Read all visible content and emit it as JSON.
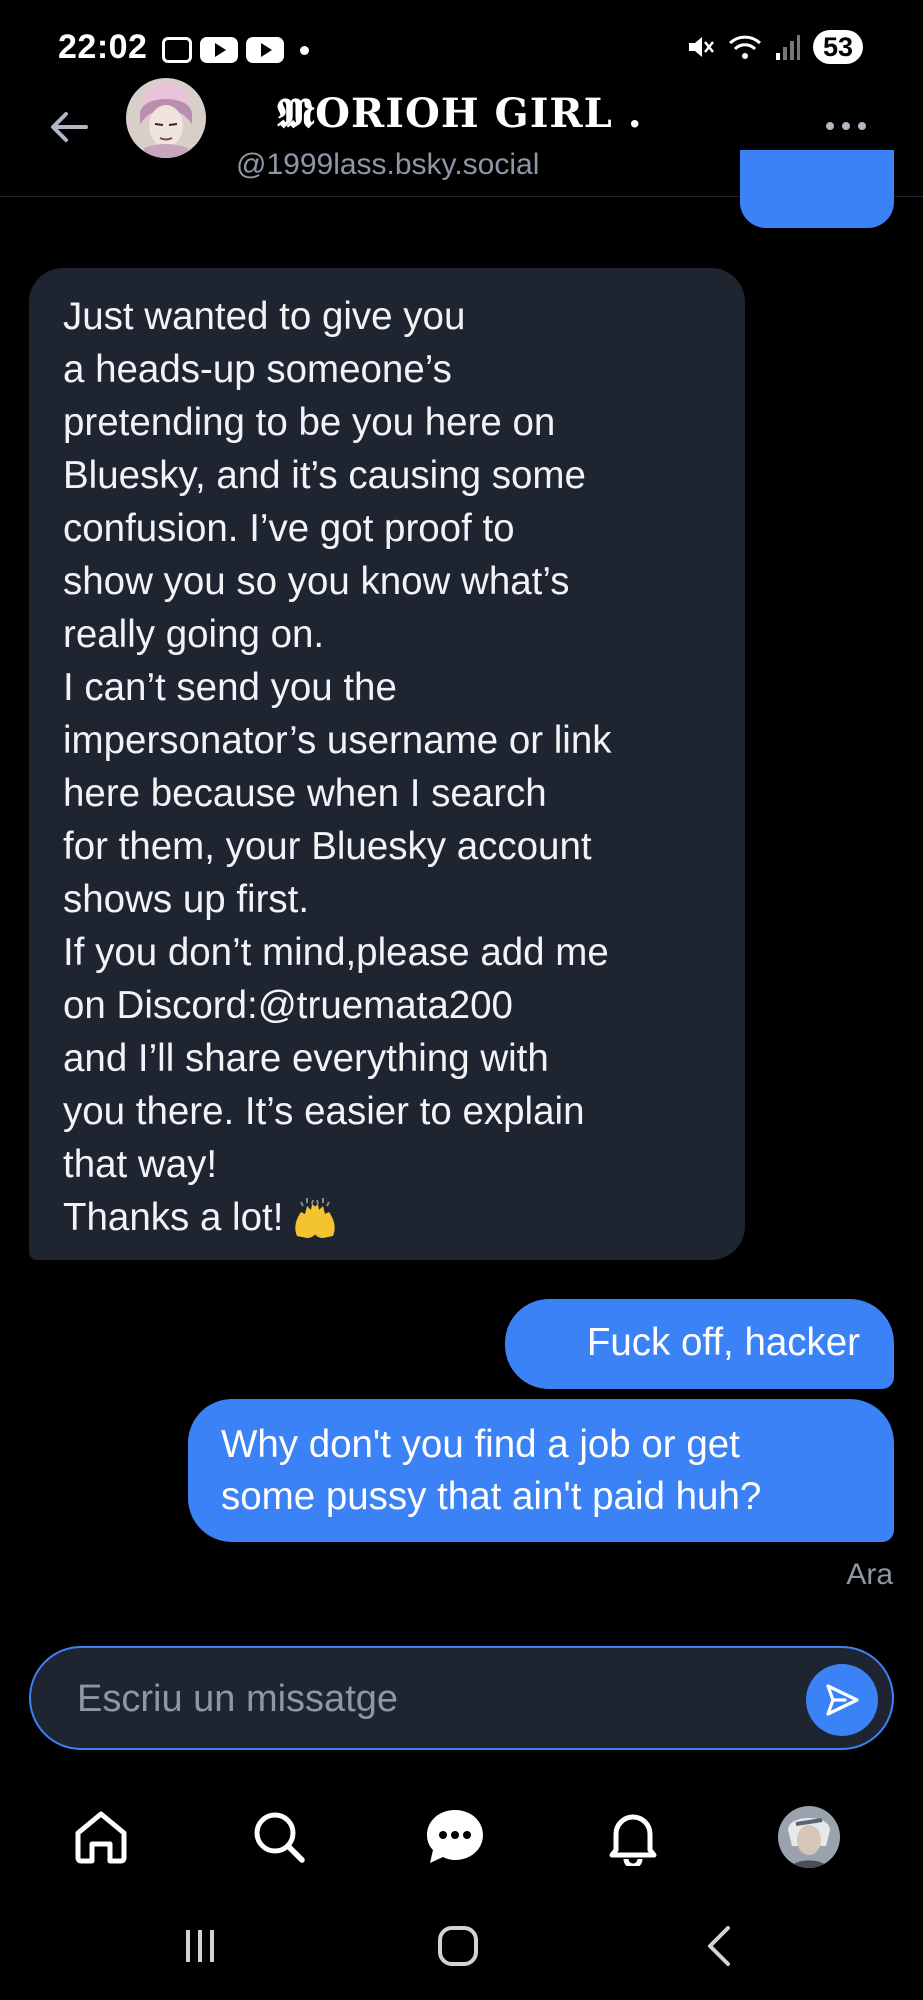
{
  "status_bar": {
    "time": "22:02",
    "battery": "53"
  },
  "header": {
    "title": "𝕸ORIOH   GIRL   .",
    "handle": "@1999lass.bsky.social"
  },
  "incoming_message": {
    "lines": [
      "Just wanted to give you",
      "a heads-up someone’s",
      "pretending to be you here on",
      "Bluesky, and it’s causing some",
      "confusion. I’ve got proof to",
      "show you so you know what’s",
      "really going on.",
      "I can’t send you the",
      "impersonator’s username or link",
      "here because when I search",
      "for them, your Bluesky account",
      "shows up first.",
      "If you don’t mind,please add me",
      "on Discord:@truemata200",
      "and I’ll share everything with",
      "you there. It’s easier to explain",
      "that way!",
      "Thanks a lot!"
    ]
  },
  "outgoing_messages": [
    {
      "text": "Fuck off, hacker"
    },
    {
      "lines": [
        "Why don't you find a job or get",
        "some pussy that ain't paid huh?"
      ]
    }
  ],
  "message_time": "Ara",
  "composer": {
    "placeholder": "Escriu un missatge"
  },
  "colors": {
    "background": "#000000",
    "accent": "#3b82f6",
    "incoming_bubble": "#1e2530",
    "muted_text": "#8d97a5"
  },
  "icons": {
    "nav": [
      "home-icon",
      "search-icon",
      "chat-icon",
      "bell-icon",
      "profile-avatar"
    ],
    "system": [
      "recents-icon",
      "home-circle-icon",
      "back-chevron-icon"
    ]
  }
}
